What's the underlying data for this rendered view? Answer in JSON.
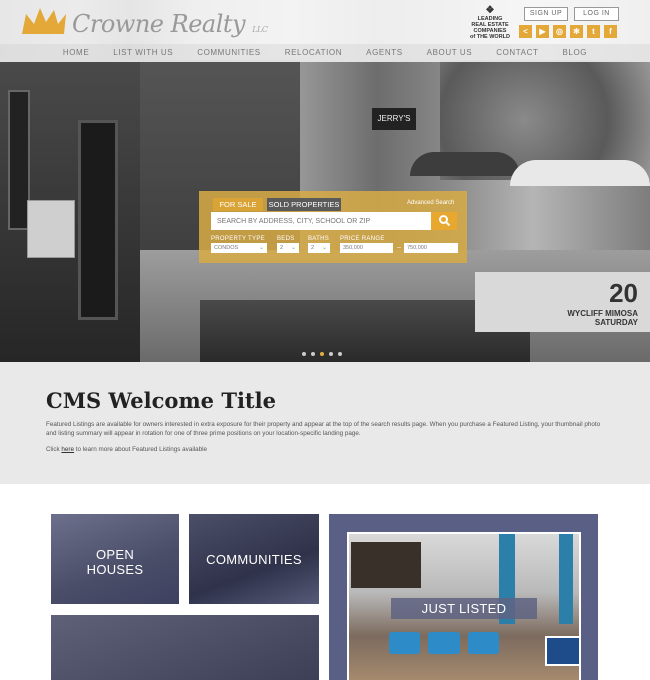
{
  "header": {
    "logo_text": "Crowne Realty",
    "logo_suffix": "LLC",
    "affiliation": {
      "line1": "LEADING",
      "line2": "REAL ESTATE",
      "line3": "COMPANIES",
      "line4": "of THE WORLD"
    },
    "sign_up": "SIGN UP",
    "log_in": "LOG IN",
    "socials": [
      {
        "icon": "share-icon",
        "glyph": "<"
      },
      {
        "icon": "youtube-icon",
        "glyph": "▶"
      },
      {
        "icon": "instagram-icon",
        "glyph": "◎"
      },
      {
        "icon": "yelp-icon",
        "glyph": "✻"
      },
      {
        "icon": "twitter-icon",
        "glyph": "t"
      },
      {
        "icon": "facebook-icon",
        "glyph": "f"
      }
    ]
  },
  "nav": [
    "HOME",
    "LIST WITH US",
    "COMMUNITIES",
    "RELOCATION",
    "AGENTS",
    "ABOUT US",
    "CONTACT",
    "BLOG"
  ],
  "hero_signs": {
    "jerrys": "JERRY'S",
    "big_number": "20",
    "wycliff": "WYCLIFF MIMOSA",
    "saturday": "SATURDAY"
  },
  "search": {
    "tab_for_sale": "FOR SALE",
    "tab_sold": "SOLD PROPERTIES",
    "advanced": "Advanced Search",
    "placeholder": "SEARCH BY ADDRESS, CITY, SCHOOL OR ZIP",
    "property_type_label": "PROPERTY TYPE",
    "property_type_value": "CONDOS",
    "beds_label": "BEDS",
    "beds_value": "2",
    "baths_label": "BATHS",
    "baths_value": "2",
    "price_label": "PRICE RANGE",
    "price_min": "350,000",
    "price_max": "750,000",
    "dash": "–"
  },
  "welcome": {
    "title": "CMS Welcome Title",
    "body": "Featured Listings are available for owners interested in extra exposure for their property and appear at the top of the search results page. When you purchase a Featured Listing, your thumbnail photo and listing summary will appear in rotation for one of three prime positions on your location-specific landing page.",
    "link_prefix": "Click ",
    "link_text": "here",
    "link_suffix": " to learn more about Featured Listings available"
  },
  "tiles": {
    "open_houses_1": "OPEN",
    "open_houses_2": "HOUSES",
    "communities": "COMMUNITIES",
    "just_listed": "JUST LISTED"
  },
  "slider": {
    "count": 5,
    "active": 3
  },
  "colors": {
    "accent": "#e3a838",
    "nav_text": "#777777",
    "tile_overlay": "#5a5f86"
  }
}
